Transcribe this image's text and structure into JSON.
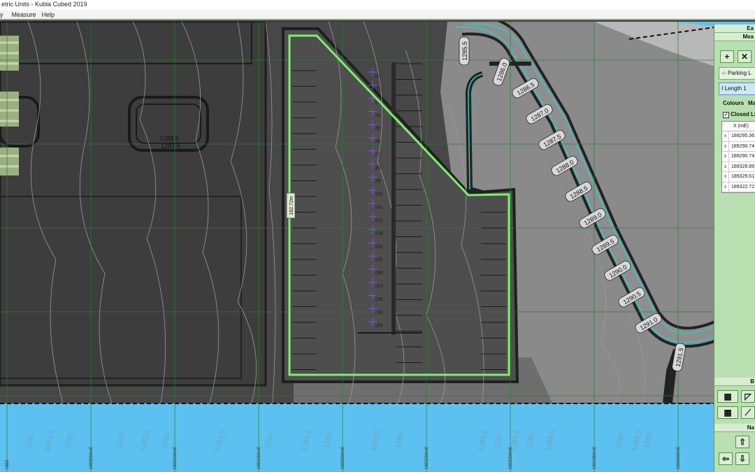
{
  "window": {
    "title": "etric Units - Kubla Cubed 2019"
  },
  "menu": {
    "items": [
      "y",
      "Measure",
      "Help"
    ]
  },
  "map": {
    "colors": {
      "background": "#4a4a4a",
      "pad_dark": "#3b3b3b",
      "terrain_light": "#8c8c8c",
      "water": "#5cc0f0",
      "grid": "#2e7d32",
      "outline": "#7cf06a",
      "road_edge": "#32c8c8"
    },
    "contour_labels_road": [
      "1285.5",
      "1286.0",
      "1286.5",
      "1287.0",
      "1287.5",
      "1288.0",
      "1288.5",
      "1289.0",
      "1289.5",
      "1290.0",
      "1290.5",
      "1291.0",
      "1291.5"
    ],
    "contour_labels_left": [
      "1288.5",
      "1287.5"
    ],
    "bottom_contour_labels": [
      "1281",
      "1281.5",
      "1282",
      "1282",
      "1282.5",
      "1283",
      "1283.5",
      "1284",
      "1284.5",
      "1285",
      "1285.5",
      "1286",
      "1286.5",
      "1287",
      "1287.5",
      "1288",
      "1288.5",
      "1289",
      "1289.5",
      "1290"
    ],
    "grid_labels": [
      "1893",
      "1893050mE",
      "1893100mE",
      "1893150mE",
      "1893200mE",
      "1893250mE",
      "1893300mE",
      "1893350mE",
      "1893400mE"
    ],
    "length_tag": "182.72m",
    "parking_numbers": [
      "(1)",
      "(2)",
      "(3)",
      "(4)",
      "(5)",
      "(6)",
      "(7)",
      "(8)",
      "(9)",
      "(10)",
      "(11)",
      "(12)",
      "(13)",
      "(14)",
      "(15)",
      "(16)",
      "(17)",
      "(18)",
      "(19)",
      "(20)"
    ]
  },
  "panel": {
    "header_top": "Ea",
    "header_measure": "Mea",
    "add_label": "+",
    "delete_label": "✕",
    "parking_label": "Parking L",
    "length_label": "Length 1",
    "colours_label": "Colours",
    "ma_label": "Ma",
    "closed_label": "Closed Li",
    "table_header": "X (mE)",
    "table_values": [
      "189295.36",
      "189290.74",
      "189290.74",
      "189329.89",
      "189329.61",
      "189322.72"
    ],
    "pm_symbol": "±",
    "section_b": "B",
    "section_na": "Na"
  }
}
